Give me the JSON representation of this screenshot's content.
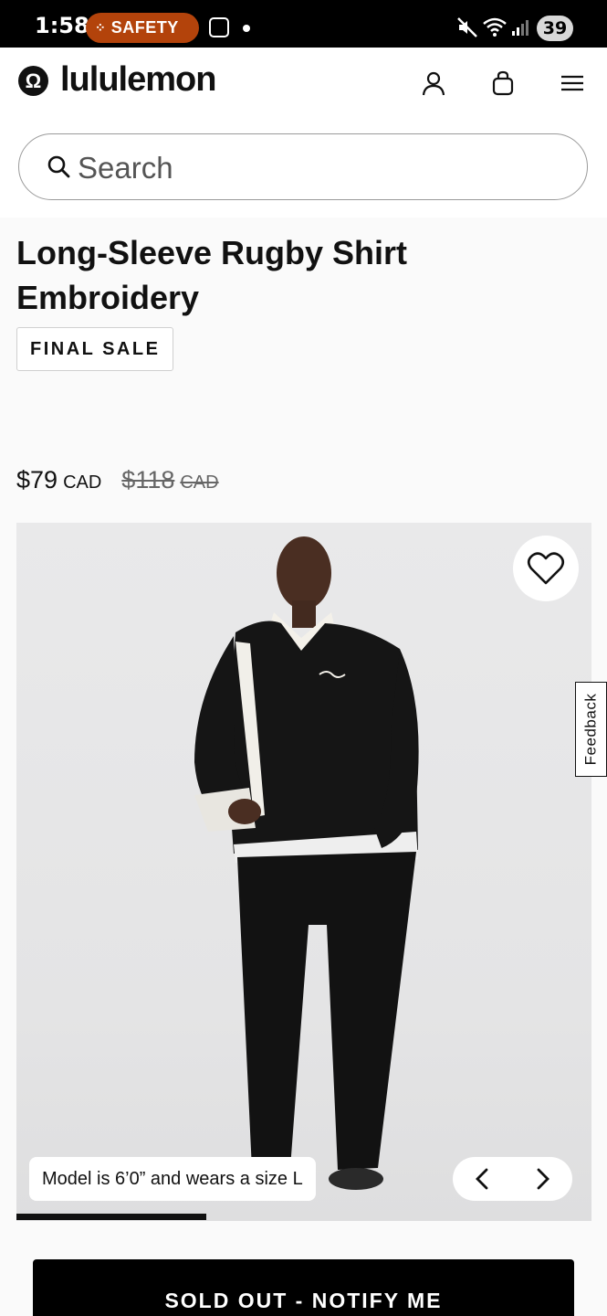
{
  "status_bar": {
    "time": "1:58",
    "safety_label": "SAFETY",
    "battery": "39"
  },
  "header": {
    "brand": "lululemon",
    "brand_mark": "Ω",
    "icons": [
      "account-icon",
      "bag-icon",
      "menu-icon"
    ]
  },
  "search": {
    "placeholder": "Search"
  },
  "product": {
    "title": "Long-Sleeve Rugby Shirt Embroidery",
    "badge": "FINAL SALE",
    "price": "$79",
    "currency": "CAD",
    "original_price": "$118",
    "original_currency": "CAD",
    "model_caption": "Model is 6’0” and wears a size L",
    "image_progress": 0.33
  },
  "feedback_label": "Feedback",
  "cta": {
    "label": "SOLD OUT - NOTIFY ME"
  },
  "colors": {
    "status_bg": "#000000",
    "safety_pill": "#b3430b",
    "page_bg": "#fafafa",
    "cta_bg": "#000000",
    "shirt": "#151515",
    "collar": "#f4f1ea"
  }
}
